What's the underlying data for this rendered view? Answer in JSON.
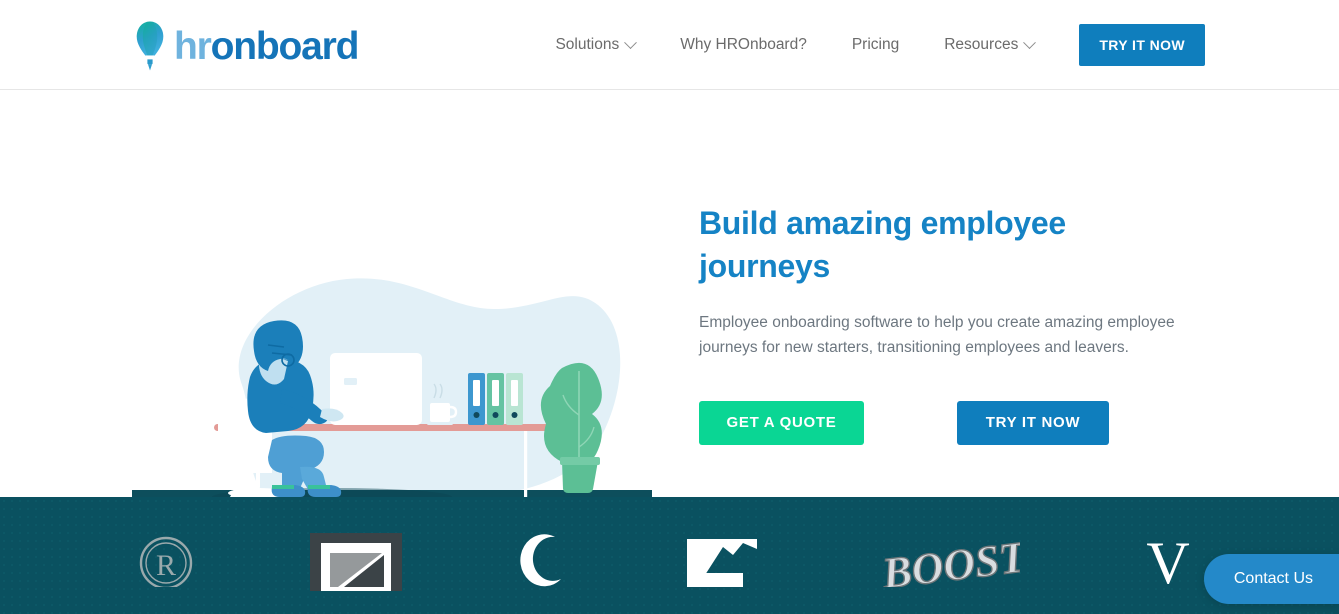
{
  "brand": {
    "name_light": "hr",
    "name_dark": "onboard",
    "logo_icon": "hot-air-balloon-icon",
    "colors": {
      "primary_blue": "#0f7ebd",
      "heading_blue": "#1583c5",
      "logo_light_blue": "#6fb3de",
      "accent_green": "#0ad694",
      "band_teal": "#0a5160",
      "contact_blue": "#2489c9",
      "body_text": "#6d7780",
      "nav_text": "#6b6b6b"
    }
  },
  "header": {
    "nav_items": [
      {
        "label": "Solutions",
        "has_dropdown": true
      },
      {
        "label": "Why HROnboard?",
        "has_dropdown": false
      },
      {
        "label": "Pricing",
        "has_dropdown": false
      },
      {
        "label": "Resources",
        "has_dropdown": true
      }
    ],
    "cta_label": "TRY IT NOW"
  },
  "hero": {
    "title": "Build amazing employee journeys",
    "subtitle": "Employee onboarding software to help you create amazing employee journeys for new starters, transitioning employees and leavers.",
    "primary_button": "GET A QUOTE",
    "secondary_button": "TRY IT NOW",
    "illustration": "person-at-desk-working-on-computer"
  },
  "client_band": {
    "logos": [
      {
        "name": "circled-r-logo",
        "label": "R"
      },
      {
        "name": "framed-square-logo",
        "label": ""
      },
      {
        "name": "crescent-o-logo",
        "label": ""
      },
      {
        "name": "mountain-flag-logo",
        "label": ""
      },
      {
        "name": "boost-logo",
        "label": "BOOST"
      },
      {
        "name": "serif-v-logo",
        "label": "V"
      }
    ]
  },
  "widgets": {
    "contact_label": "Contact Us"
  }
}
